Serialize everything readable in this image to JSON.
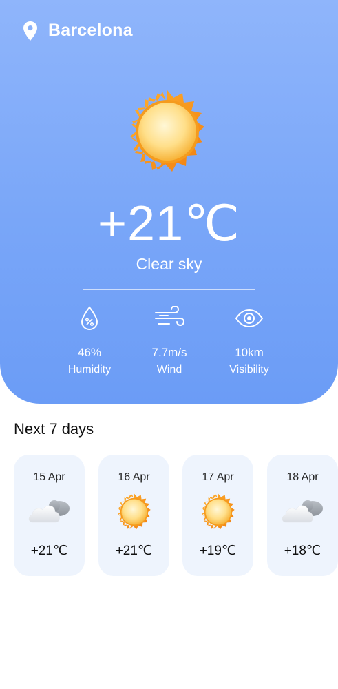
{
  "header": {
    "location": "Barcelona",
    "location_icon": "map-pin-icon"
  },
  "current": {
    "icon": "sun-icon",
    "temperature": "+21℃",
    "condition": "Clear sky"
  },
  "stats": [
    {
      "icon": "humidity-drop-icon",
      "value": "46%",
      "label": "Humidity"
    },
    {
      "icon": "wind-icon",
      "value": "7.7m/s",
      "label": "Wind"
    },
    {
      "icon": "eye-icon",
      "value": "10km",
      "label": "Visibility"
    }
  ],
  "forecast": {
    "title": "Next 7 days",
    "days": [
      {
        "date": "15 Apr",
        "icon": "cloudy-icon",
        "temp": "+21℃"
      },
      {
        "date": "16 Apr",
        "icon": "sun-icon",
        "temp": "+21℃"
      },
      {
        "date": "17 Apr",
        "icon": "sun-icon",
        "temp": "+19℃"
      },
      {
        "date": "18 Apr",
        "icon": "cloudy-icon",
        "temp": "+18℃"
      }
    ]
  },
  "colors": {
    "hero_top": "#8fb5fb",
    "hero_bottom": "#6b9cf6",
    "card_bg": "#eef4fd",
    "sun": "#f6a623"
  }
}
